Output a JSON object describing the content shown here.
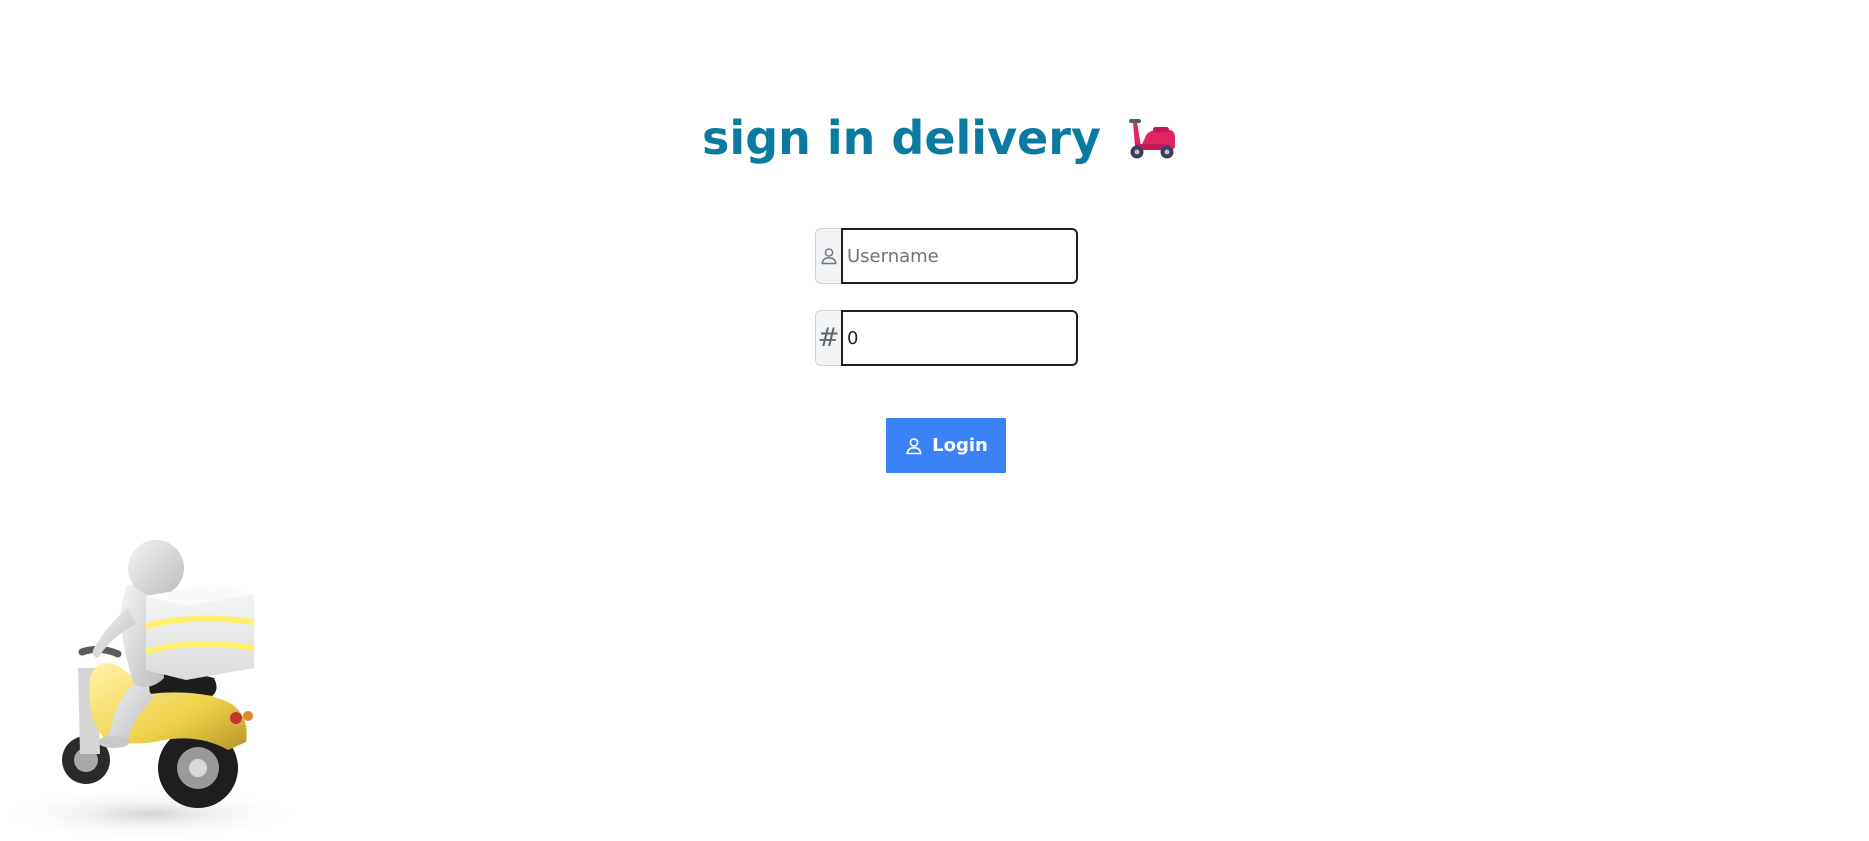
{
  "header": {
    "title": "sign in delivery",
    "title_icon": "scooter-icon"
  },
  "form": {
    "username": {
      "icon": "user-icon",
      "value": "",
      "placeholder": "Username"
    },
    "code": {
      "icon": "hash-icon",
      "addon_text": "#",
      "value": "0"
    },
    "login_button": {
      "icon": "user-icon",
      "label": "Login"
    }
  },
  "illustration": {
    "icon": "delivery-courier-scooter-illustration"
  },
  "colors": {
    "title": "#0b7aa0",
    "button": "#3b82f6",
    "addon_background": "#f1f3f5"
  }
}
